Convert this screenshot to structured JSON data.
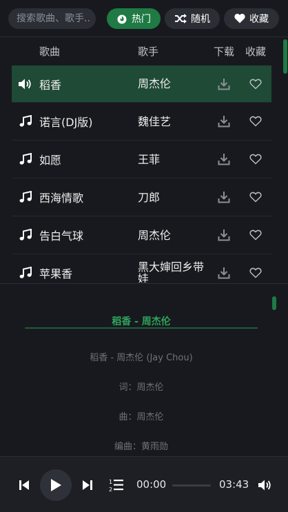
{
  "search": {
    "placeholder": "搜索歌曲、歌手..."
  },
  "filters": {
    "hot": "热门",
    "random": "随机",
    "favorites": "收藏"
  },
  "table": {
    "headers": {
      "song": "歌曲",
      "artist": "歌手",
      "download": "下载",
      "favorite": "收藏"
    },
    "rows": [
      {
        "title": "稻香",
        "artist": "周杰伦",
        "active": true
      },
      {
        "title": "诺言(DJ版)",
        "artist": "魏佳艺",
        "active": false
      },
      {
        "title": "如愿",
        "artist": "王菲",
        "active": false
      },
      {
        "title": "西海情歌",
        "artist": "刀郎",
        "active": false
      },
      {
        "title": "告白气球",
        "artist": "周杰伦",
        "active": false
      },
      {
        "title": "苹果香",
        "artist": "黑大婶回乡带娃",
        "active": false
      }
    ]
  },
  "lyrics": {
    "title": "稻香 - 周杰伦",
    "lines": [
      "稻香 - 周杰伦 (Jay Chou)",
      "词：周杰伦",
      "曲：周杰伦",
      "编曲：黄雨勋"
    ]
  },
  "player": {
    "current_time": "00:00",
    "duration": "03:43",
    "progress": 0
  },
  "colors": {
    "accent": "#1f7a44",
    "active_row": "#1f4a35",
    "lyric_title": "#2fa35b",
    "background": "#17191e"
  },
  "icons": {
    "hot": "flame-icon",
    "random": "shuffle-icon",
    "favorites": "heart-filled-icon",
    "playing_row": "speaker-icon",
    "row": "music-note-icon",
    "download": "download-icon",
    "favorite": "heart-outline-icon",
    "prev": "previous-icon",
    "play": "play-icon",
    "next": "next-icon",
    "playlist": "playlist-icon",
    "volume": "volume-icon"
  }
}
